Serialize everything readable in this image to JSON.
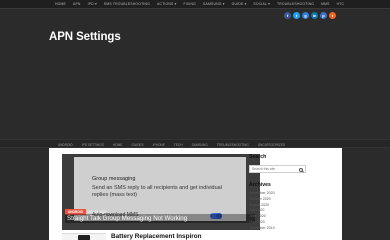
{
  "topnav": {
    "items": [
      "HOME",
      "APN",
      "IPD ▾",
      "SMS TROUBLESHOOTING",
      "ACTIONS ▾",
      "FIXING",
      "SAMSUNG ▾",
      "GUIDE ▾",
      "SOCIAL ▾",
      "TROUBLESHOOTING",
      "MMS",
      "HTC"
    ]
  },
  "social": [
    {
      "name": "facebook-icon",
      "glyph": "f",
      "color": "#3b5998"
    },
    {
      "name": "twitter-icon",
      "glyph": "t",
      "color": "#1da1f2"
    },
    {
      "name": "googleplus-icon",
      "glyph": "g",
      "color": "#2f7fd8"
    },
    {
      "name": "linkedin-icon",
      "glyph": "in",
      "color": "#0e76a8"
    },
    {
      "name": "pinterest-icon",
      "glyph": "p",
      "color": "#3d71c4"
    },
    {
      "name": "rss-icon",
      "glyph": "r",
      "color": "#f26522"
    }
  ],
  "site": {
    "title": "APN Settings"
  },
  "mainnav": {
    "items": [
      "ANDROID",
      "IPD SETTINGS",
      "HOME",
      "GUIDES",
      "IPHONE",
      "TECH",
      "SAMSUNG",
      "TROUBLESHOOTING",
      "UNCATEGORIZED"
    ]
  },
  "featured": {
    "screenshot_title": "Group messaging",
    "screenshot_desc": "Send an SMS reply to all recipients and get individual replies (mass text)",
    "screenshot_sub": "Auto-download MMS",
    "category": "ANDROID",
    "date": "JUL 09, 2020",
    "title": "Straight Talk Group Messaging Not Working"
  },
  "post": {
    "title": "Battery Replacement Inspiron"
  },
  "sidebar": {
    "search_heading": "Search",
    "search_placeholder": "Search this site",
    "archives_heading": "Archives",
    "archives": [
      "December 2020",
      "October 2020",
      "August 2020",
      "July 2020",
      "June 2020",
      "May 2020",
      "November 2019"
    ]
  }
}
